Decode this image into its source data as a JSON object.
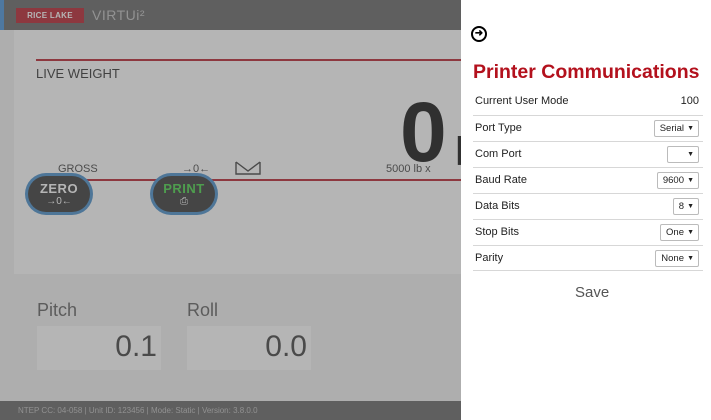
{
  "header": {
    "brand": "RICE LAKE",
    "product": "VIRTUi²"
  },
  "scale": {
    "live_label": "LIVE WEIGHT",
    "weight_value": "0",
    "weight_unit_fragment": "l",
    "gross_label": "GROSS",
    "zero_indicator": "→0←",
    "capacity": "5000 lb x"
  },
  "buttons": {
    "zero": {
      "label": "ZERO",
      "sub": "→0←"
    },
    "print": {
      "label": "PRINT",
      "sub": "⎙"
    }
  },
  "sensors": {
    "pitch": {
      "label": "Pitch",
      "value": "0.1"
    },
    "roll": {
      "label": "Roll",
      "value": "0.0"
    }
  },
  "footer": {
    "text": "NTEP CC: 04-058 | Unit ID: 123456 | Mode: Static | Version: 3.8.0.0"
  },
  "panel": {
    "back_icon": "arrow-right-circle-icon",
    "title": "Printer Communications",
    "current_user_mode": {
      "label": "Current User Mode",
      "value": "100"
    },
    "port_type": {
      "label": "Port Type",
      "value": "Serial"
    },
    "com_port": {
      "label": "Com Port",
      "value": ""
    },
    "baud_rate": {
      "label": "Baud Rate",
      "value": "9600"
    },
    "data_bits": {
      "label": "Data Bits",
      "value": "8"
    },
    "stop_bits": {
      "label": "Stop Bits",
      "value": "One"
    },
    "parity": {
      "label": "Parity",
      "value": "None"
    },
    "save_label": "Save"
  },
  "colors": {
    "accent_red": "#b3111d",
    "overlay": "#646464",
    "print_green": "#3bd23b"
  }
}
